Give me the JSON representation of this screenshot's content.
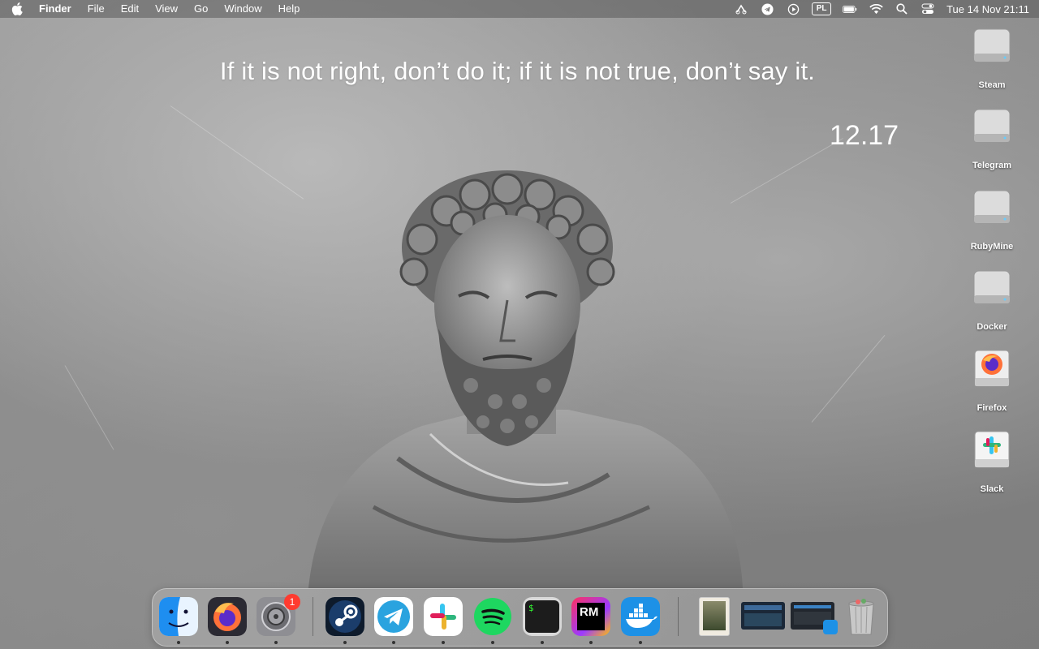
{
  "menubar": {
    "app_name": "Finder",
    "menus": [
      "File",
      "Edit",
      "View",
      "Go",
      "Window",
      "Help"
    ],
    "status_icons": [
      "scissors-paw-icon",
      "telegram-icon",
      "play-icon",
      "keyboard-layout-icon",
      "battery-icon",
      "wifi-icon",
      "search-icon",
      "control-center-icon"
    ],
    "input_source": "PL",
    "datetime": "Tue 14 Nov  21:11"
  },
  "wallpaper": {
    "quote": "If it is not right, don’t do it; if it is not true, don’t say it.",
    "time": "12.17"
  },
  "desktop_icons": [
    {
      "label": "Steam",
      "icon": "drive-icon"
    },
    {
      "label": "Telegram",
      "icon": "drive-icon"
    },
    {
      "label": "RubyMine",
      "icon": "drive-icon"
    },
    {
      "label": "Docker",
      "icon": "drive-icon"
    },
    {
      "label": "Firefox",
      "icon": "firefox-disk-icon"
    },
    {
      "label": "Slack",
      "icon": "slack-disk-icon"
    }
  ],
  "dock": {
    "apps": [
      {
        "name": "Finder",
        "running": true
      },
      {
        "name": "Firefox",
        "running": true
      },
      {
        "name": "System Preferences",
        "running": true,
        "badge": "1"
      },
      {
        "name": "Steam",
        "running": true
      },
      {
        "name": "Telegram",
        "running": true
      },
      {
        "name": "Slack",
        "running": true
      },
      {
        "name": "Spotify",
        "running": true
      },
      {
        "name": "Terminal",
        "running": true
      },
      {
        "name": "RubyMine",
        "running": true
      },
      {
        "name": "Docker",
        "running": true
      }
    ],
    "rubymine_text": "RM",
    "terminal_prompt": "$",
    "trash": "Trash"
  },
  "colors": {
    "badge": "#ff3b30",
    "finder_blue": "#1e8ef0",
    "telegram_blue": "#2aa3df",
    "spotify_green": "#1ed760",
    "docker_blue": "#1d91e6"
  }
}
